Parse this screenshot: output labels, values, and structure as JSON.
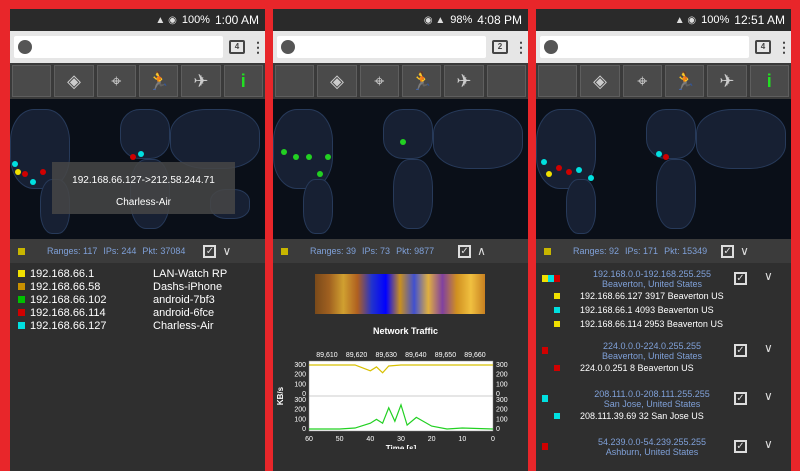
{
  "phones": [
    {
      "status_time": "1:00 AM",
      "status_battery": "100%",
      "tab_count": "4",
      "ranges": "Ranges: 117",
      "ips": "IPs: 244",
      "pkt": "Pkt: 37084",
      "tooltip_line1": "192.168.66.127->212.58.244.71",
      "tooltip_line2": "Charless-Air",
      "hosts": [
        {
          "ip": "192.168.66.1",
          "name": "LAN-Watch RP",
          "color": "#f0e000"
        },
        {
          "ip": "192.168.66.58",
          "name": "Dashs-iPhone",
          "color": "#c89000"
        },
        {
          "ip": "192.168.66.102",
          "name": "android-7bf3",
          "color": "#00c000"
        },
        {
          "ip": "192.168.66.114",
          "name": "android-6fce",
          "color": "#d00000"
        },
        {
          "ip": "192.168.66.127",
          "name": "Charless-Air",
          "color": "#00e0e0"
        }
      ]
    },
    {
      "status_time": "4:08 PM",
      "status_battery": "98%",
      "tab_count": "2",
      "ranges": "Ranges: 39",
      "ips": "IPs: 73",
      "pkt": "Pkt: 9877",
      "chart_title": "Network Traffic",
      "top_ticks": [
        "89,610",
        "89,620",
        "89,630",
        "89,640",
        "89,650",
        "89,660"
      ],
      "y_ticks": [
        "300",
        "200",
        "100",
        "0"
      ],
      "y_label": "KB/s",
      "x_ticks": [
        "60",
        "50",
        "40",
        "30",
        "20",
        "10",
        "0"
      ],
      "x_label": "Time [s]"
    },
    {
      "status_time": "12:51 AM",
      "status_battery": "100%",
      "tab_count": "4",
      "ranges": "Ranges: 92",
      "ips": "IPs: 171",
      "pkt": "Pkt: 15349",
      "groups": [
        {
          "range": "192.168.0.0-192.168.255.255",
          "loc": "Beaverton, United States",
          "entries": [
            {
              "text": "192.168.66.127 3917  Beaverton  US",
              "color": "#f0e000"
            },
            {
              "text": "192.168.66.1 4093  Beaverton  US",
              "color": "#00e0e0"
            },
            {
              "text": "192.168.66.114 2953  Beaverton  US",
              "color": "#f0e000"
            }
          ]
        },
        {
          "range": "224.0.0.0-224.0.255.255",
          "loc": "Beaverton, United States",
          "entries": [
            {
              "text": "224.0.0.251 8  Beaverton  US",
              "color": "#d00000"
            }
          ]
        },
        {
          "range": "208.111.0.0-208.111.255.255",
          "loc": "San Jose, United States",
          "entries": [
            {
              "text": "208.111.39.69 32  San Jose  US",
              "color": "#00e0e0"
            }
          ]
        },
        {
          "range": "54.239.0.0-54.239.255.255",
          "loc": "Ashburn, United States",
          "entries": []
        }
      ]
    }
  ],
  "chart_data": {
    "type": "line",
    "title": "Network Traffic",
    "xlabel": "Time [s]",
    "ylabel": "KB/s",
    "xlim": [
      60,
      0
    ],
    "ylim": [
      0,
      300
    ],
    "series": [
      {
        "color": "#d8c000",
        "x": [
          60,
          50,
          45,
          40,
          38,
          36,
          34,
          30,
          25,
          20,
          10,
          0
        ],
        "values": [
          0,
          0,
          0,
          60,
          20,
          80,
          10,
          0,
          0,
          0,
          0,
          0
        ]
      },
      {
        "color": "#22d022",
        "x": [
          60,
          50,
          45,
          40,
          38,
          36,
          34,
          32,
          30,
          28,
          25,
          20,
          15,
          10,
          0
        ],
        "values": [
          0,
          0,
          10,
          60,
          100,
          60,
          220,
          80,
          250,
          40,
          120,
          30,
          0,
          10,
          0
        ]
      }
    ]
  }
}
